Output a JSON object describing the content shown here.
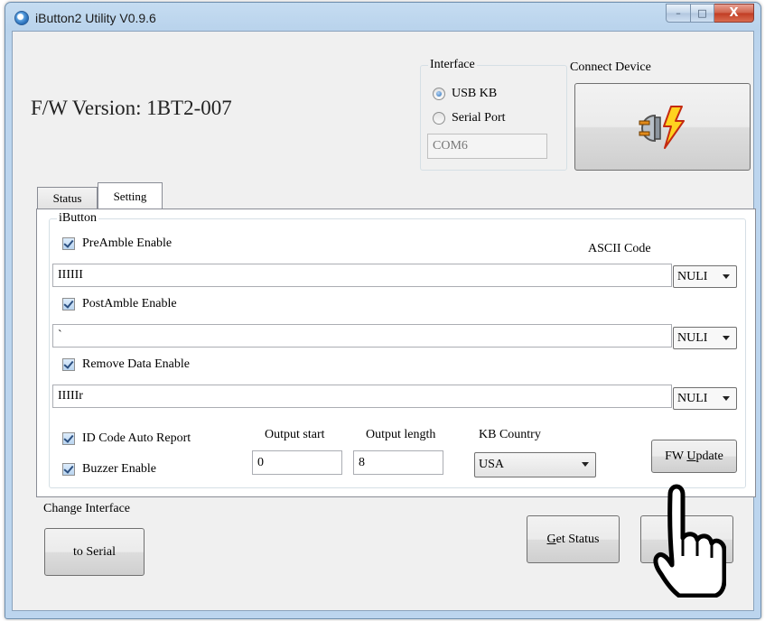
{
  "window": {
    "title": "iButton2 Utility V0.9.6",
    "close_glyph": "X",
    "minimize_glyph": "–",
    "maximize_glyph": "□"
  },
  "header": {
    "fw_version": "F/W Version: 1BT2-007"
  },
  "interface": {
    "label": "Interface",
    "options": [
      "USB KB",
      "Serial Port"
    ],
    "selected": "USB KB",
    "com_port": "COM6"
  },
  "connect": {
    "label": "Connect Device",
    "icon": "plug-lightning-icon"
  },
  "tabs": [
    {
      "label": "Status",
      "active": false
    },
    {
      "label": "Setting",
      "active": true
    }
  ],
  "ibutton": {
    "group_label": "iButton",
    "ascii_code_label": "ASCII Code",
    "preamble": {
      "label": "PreAmble Enable",
      "checked": true,
      "value": "IIIIII",
      "ascii": "NULI"
    },
    "postamble": {
      "label": "PostAmble Enable",
      "checked": true,
      "value": "`",
      "ascii": "NULI"
    },
    "remove_data": {
      "label": "Remove Data Enable",
      "checked": true,
      "value": "IIIIIr",
      "ascii": "NULI"
    },
    "id_code_auto_report": {
      "label": "ID Code Auto Report",
      "checked": true
    },
    "buzzer": {
      "label": "Buzzer Enable",
      "checked": true
    },
    "output_start": {
      "label": "Output start",
      "value": "0"
    },
    "output_length": {
      "label": "Output length",
      "value": "8"
    },
    "kb_country": {
      "label": "KB Country",
      "value": "USA"
    },
    "fw_update": {
      "label_pre": "FW ",
      "label_acc": "U",
      "label_post": "pdate"
    }
  },
  "change_interface": {
    "label": "Change Interface",
    "button": "to Serial"
  },
  "get_status": {
    "label_acc": "G",
    "label_post": "et Status"
  },
  "overlay": {
    "icon": "pointing-hand-icon"
  },
  "colors": {
    "title_bar": "#b9d3ec",
    "close_button": "#c13c23",
    "client_bg": "#f0f0f0"
  }
}
